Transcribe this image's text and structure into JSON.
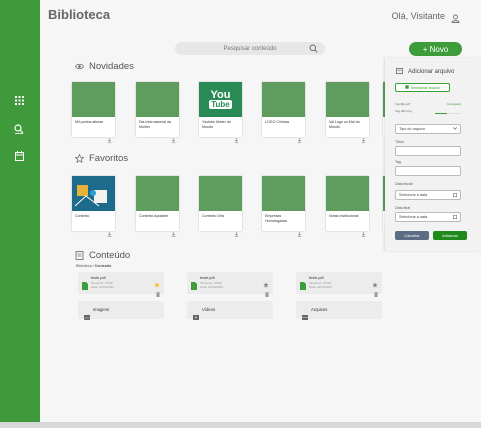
{
  "app": {
    "title": "Biblioteca",
    "greeting": "Olá, Visitante"
  },
  "search": {
    "placeholder": "Pesquisar conteúdo"
  },
  "new_button": {
    "label": "+ Novo"
  },
  "sections": {
    "news": "Novidades",
    "favorites": "Favoritos",
    "content": "Conteúdo"
  },
  "novidades": [
    {
      "name": "Mil pontos alturas"
    },
    {
      "name": "Dia Internacional da Mulher"
    },
    {
      "name": "Youtube Mister do Mundo"
    },
    {
      "name": "LOGO Clínicas"
    },
    {
      "name": "Vai Logo ou Mal do Mundo"
    }
  ],
  "favoritos": [
    {
      "name": "Contexto"
    },
    {
      "name": "Contexto Apoiante"
    },
    {
      "name": "Contexto Orla"
    },
    {
      "name": "Empresas Homologadas"
    },
    {
      "name": "Notas Institucional"
    }
  ],
  "breadcrumb": {
    "root": "Biblioteca",
    "sep": "/",
    "current": "Conteúdo"
  },
  "files": [
    {
      "name": "teste.pdf",
      "size": "Tamanho: 375kb",
      "date": "Data: 22/04/2024",
      "favorite": true
    },
    {
      "name": "teste.pdf",
      "size": "Tamanho: 375kb",
      "date": "Data: 22/04/2024",
      "favorite": false
    },
    {
      "name": "teste.pdf",
      "size": "Tamanho: 375kb",
      "date": "Data: 22/04/2024",
      "favorite": false
    }
  ],
  "folders": [
    "Imagens",
    "Vídeos",
    "Arquivos"
  ],
  "youtube_logo": {
    "top": "You",
    "bottom": "Tube"
  },
  "panel": {
    "title": "Adicionar arquivo",
    "select_button": "Selecionar arquivo",
    "upload1": {
      "name": "Imprfile.pdf",
      "status": "Carregado"
    },
    "upload2": {
      "name": "Img 001.png",
      "progress": 0.45
    },
    "type_select": "Tipo do arquivo",
    "title_label": "Título",
    "tag_label": "Tag",
    "start_label": "Data inicial",
    "start_value": "Selecione a data",
    "end_label": "Data final",
    "end_value": "Selecione a data",
    "cancel": "Cancelar",
    "add": "Adicionar"
  },
  "colors": {
    "brand": "#3f9a3b",
    "accent": "#3e9c3a",
    "cancel": "#5b6c84",
    "thumb": "#5e9d5d"
  }
}
